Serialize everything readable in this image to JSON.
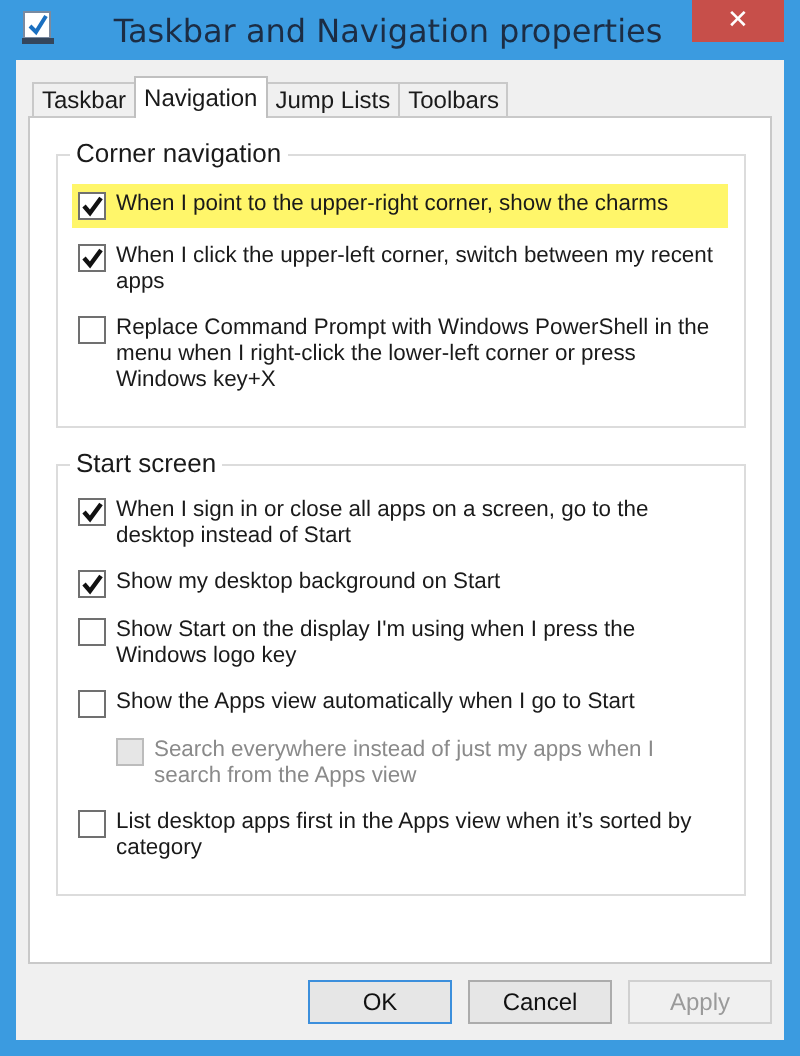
{
  "window": {
    "title": "Taskbar and Navigation properties",
    "close": "✕"
  },
  "tabs": [
    {
      "label": "Taskbar",
      "selected": false
    },
    {
      "label": "Navigation",
      "selected": true
    },
    {
      "label": "Jump Lists",
      "selected": false
    },
    {
      "label": "Toolbars",
      "selected": false
    }
  ],
  "groups": [
    {
      "title": "Corner navigation",
      "items": [
        {
          "label": "When I point to the upper-right corner, show the charms",
          "checked": true,
          "disabled": false,
          "highlighted": true
        },
        {
          "label": "When I click the upper-left corner, switch between my recent apps",
          "checked": true,
          "disabled": false,
          "highlighted": false
        },
        {
          "label": "Replace Command Prompt with Windows PowerShell in the menu when I right-click the lower-left corner or press Windows key+X",
          "checked": false,
          "disabled": false,
          "highlighted": false
        }
      ]
    },
    {
      "title": "Start screen",
      "items": [
        {
          "label": "When I sign in or close all apps on a screen, go to the desktop instead of Start",
          "checked": true,
          "disabled": false,
          "highlighted": false
        },
        {
          "label": "Show my desktop background on Start",
          "checked": true,
          "disabled": false,
          "highlighted": false
        },
        {
          "label": "Show Start on the display I'm using when I press the Windows logo key",
          "checked": false,
          "disabled": false,
          "highlighted": false
        },
        {
          "label": "Show the Apps view automatically when I go to Start",
          "checked": false,
          "disabled": false,
          "highlighted": false,
          "children": [
            {
              "label": "Search everywhere instead of just my apps when I search from the Apps view",
              "checked": false,
              "disabled": true,
              "highlighted": false
            }
          ]
        },
        {
          "label": "List desktop apps first in the Apps view when it’s sorted by category",
          "checked": false,
          "disabled": false,
          "highlighted": false
        }
      ]
    }
  ],
  "buttons": [
    {
      "label": "OK",
      "default": true,
      "disabled": false
    },
    {
      "label": "Cancel",
      "default": false,
      "disabled": false
    },
    {
      "label": "Apply",
      "default": false,
      "disabled": true
    }
  ]
}
